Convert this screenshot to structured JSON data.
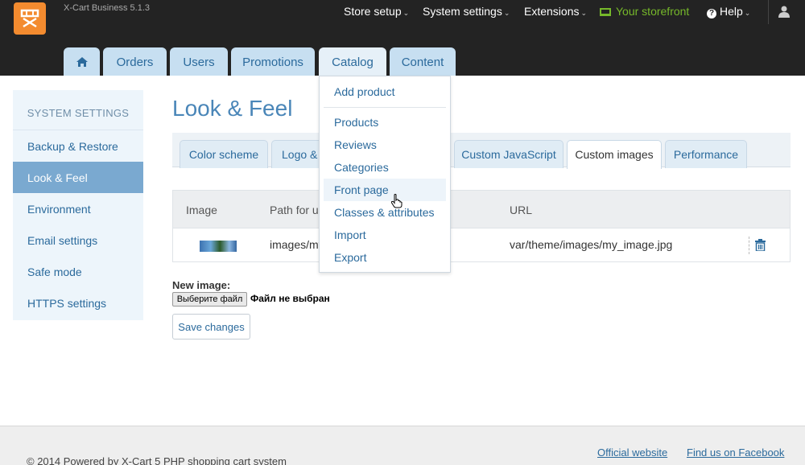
{
  "header": {
    "version": "X-Cart Business 5.1.3",
    "menu": [
      {
        "label": "Store setup"
      },
      {
        "label": "System settings"
      },
      {
        "label": "Extensions"
      },
      {
        "label": "Your storefront"
      },
      {
        "label": "Help"
      }
    ],
    "storefront_color": "#76b82a"
  },
  "main_tabs": [
    {
      "label": "Orders"
    },
    {
      "label": "Users"
    },
    {
      "label": "Promotions"
    },
    {
      "label": "Catalog"
    },
    {
      "label": "Content"
    }
  ],
  "sidebar": {
    "title": "SYSTEM SETTINGS",
    "items": [
      {
        "label": "Backup & Restore"
      },
      {
        "label": "Look & Feel"
      },
      {
        "label": "Environment"
      },
      {
        "label": "Email settings"
      },
      {
        "label": "Safe mode"
      },
      {
        "label": "HTTPS settings"
      }
    ],
    "active": "Look & Feel"
  },
  "page": {
    "title": "Look & Feel",
    "tabs": [
      {
        "label": "Color scheme"
      },
      {
        "label": "Logo & "
      },
      {
        "label": "Custom JavaScript"
      },
      {
        "label": "Custom images"
      },
      {
        "label": "Performance"
      }
    ],
    "active_tab": "Custom images"
  },
  "table": {
    "columns": [
      "Image",
      "Path for us",
      "URL"
    ],
    "rows": [
      {
        "path": "images/my",
        "url": "var/theme/images/my_image.jpg"
      }
    ]
  },
  "upload": {
    "label": "New image:",
    "button": "Выберите файл",
    "status": "Файл не выбран"
  },
  "save_label": "Save changes",
  "catalog_menu": {
    "items": [
      {
        "label": "Add product"
      },
      {
        "label": "Products"
      },
      {
        "label": "Reviews"
      },
      {
        "label": "Categories"
      },
      {
        "label": "Front page"
      },
      {
        "label": "Classes & attributes"
      },
      {
        "label": "Import"
      },
      {
        "label": "Export"
      }
    ],
    "hovered": "Front page"
  },
  "footer": {
    "copyright": "© 2014 Powered by X-Cart 5 PHP shopping cart system",
    "links": [
      {
        "label": "Official website"
      },
      {
        "label": "Find us on Facebook"
      }
    ]
  },
  "colors": {
    "header_bg": "#232323",
    "logo": "#f38b2f",
    "accent": "#2b6a9c",
    "tab_bg": "#c7dff1",
    "sidebar_active": "#7aa9d0"
  }
}
